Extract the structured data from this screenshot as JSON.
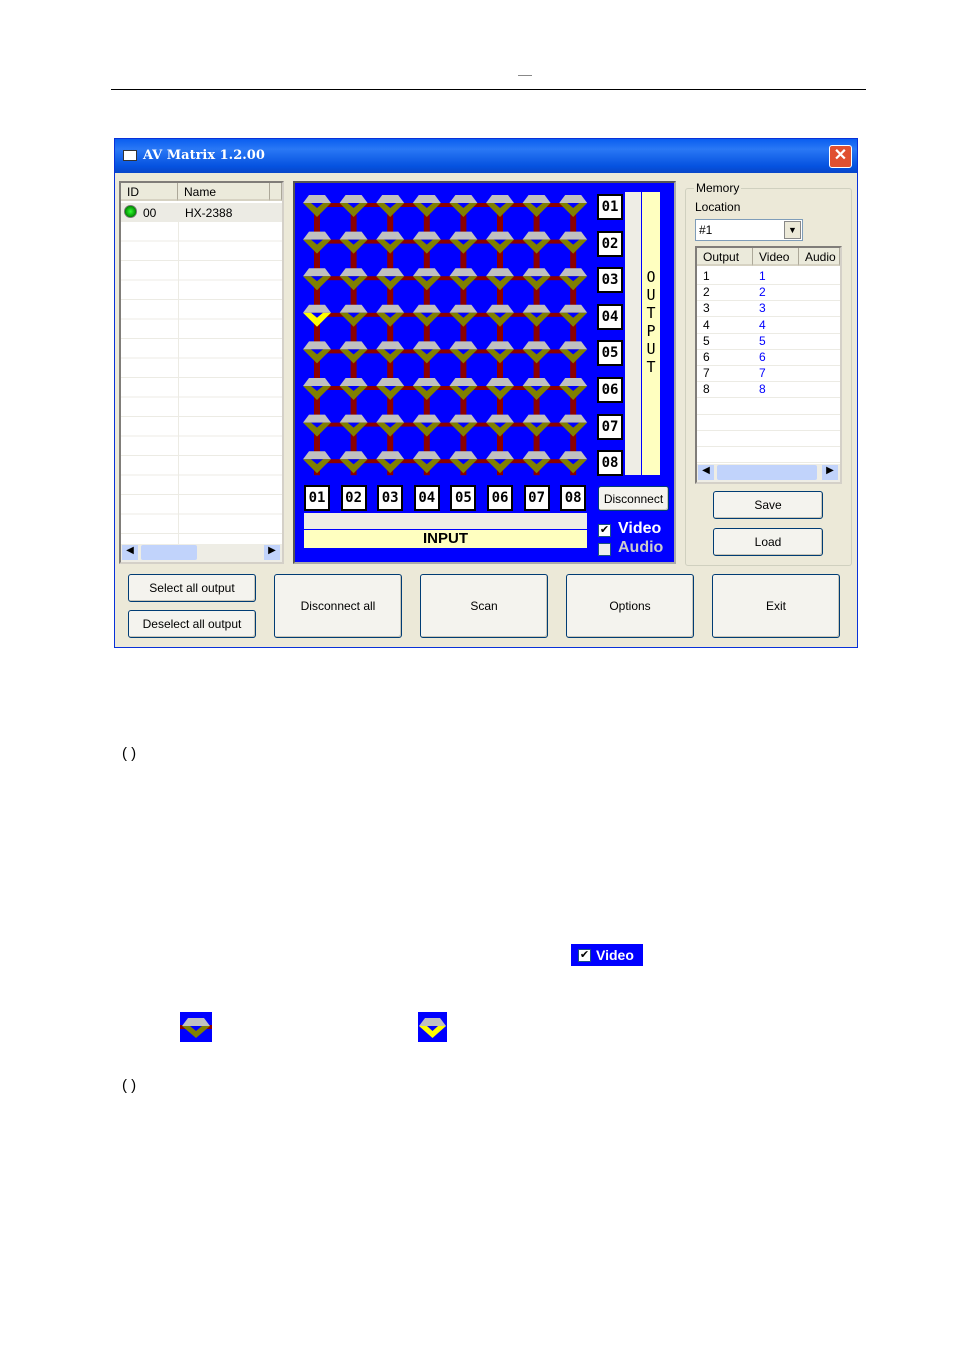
{
  "page": {
    "header_mark": "—",
    "paren_1": "(   )",
    "paren_2": "(   )"
  },
  "window": {
    "title": "AV Matrix 1.2.00",
    "close": "✕"
  },
  "device_list": {
    "columns": [
      "ID",
      "Name"
    ],
    "rows": [
      {
        "id": "00",
        "name": "HX-2388"
      }
    ]
  },
  "matrix": {
    "rows": 8,
    "cols": 8,
    "outputs": [
      "01",
      "02",
      "03",
      "04",
      "05",
      "06",
      "07",
      "08"
    ],
    "inputs": [
      "01",
      "02",
      "03",
      "04",
      "05",
      "06",
      "07",
      "08"
    ],
    "output_label": "OUTPUT",
    "input_label": "INPUT",
    "selected": [
      {
        "output": 4,
        "input": 1
      }
    ],
    "colors": {
      "panel": "#0000ff",
      "link": "#8b0000",
      "node_top": "#c0c0c0",
      "node_bottom": "#808000",
      "node_selected": "#ffff00",
      "label_bg": "#ffffc0"
    }
  },
  "disconnect_label": "Disconnect",
  "video": {
    "label": "Video",
    "checked": true
  },
  "audio": {
    "label": "Audio",
    "checked": false
  },
  "memory": {
    "group_label": "Memory",
    "location_label": "Location",
    "location_value": "#1",
    "columns": [
      "Output",
      "Video",
      "Audio"
    ],
    "rows": [
      [
        "1",
        "1",
        ""
      ],
      [
        "2",
        "2",
        ""
      ],
      [
        "3",
        "3",
        ""
      ],
      [
        "4",
        "4",
        ""
      ],
      [
        "5",
        "5",
        ""
      ],
      [
        "6",
        "6",
        ""
      ],
      [
        "7",
        "7",
        ""
      ],
      [
        "8",
        "8",
        ""
      ]
    ],
    "save": "Save",
    "load": "Load"
  },
  "buttons": {
    "select_all": "Select all output",
    "deselect_all": "Deselect all output",
    "disconnect_all": "Disconnect all",
    "scan": "Scan",
    "options": "Options",
    "exit": "Exit"
  },
  "inset": {
    "video_label": "Video"
  }
}
